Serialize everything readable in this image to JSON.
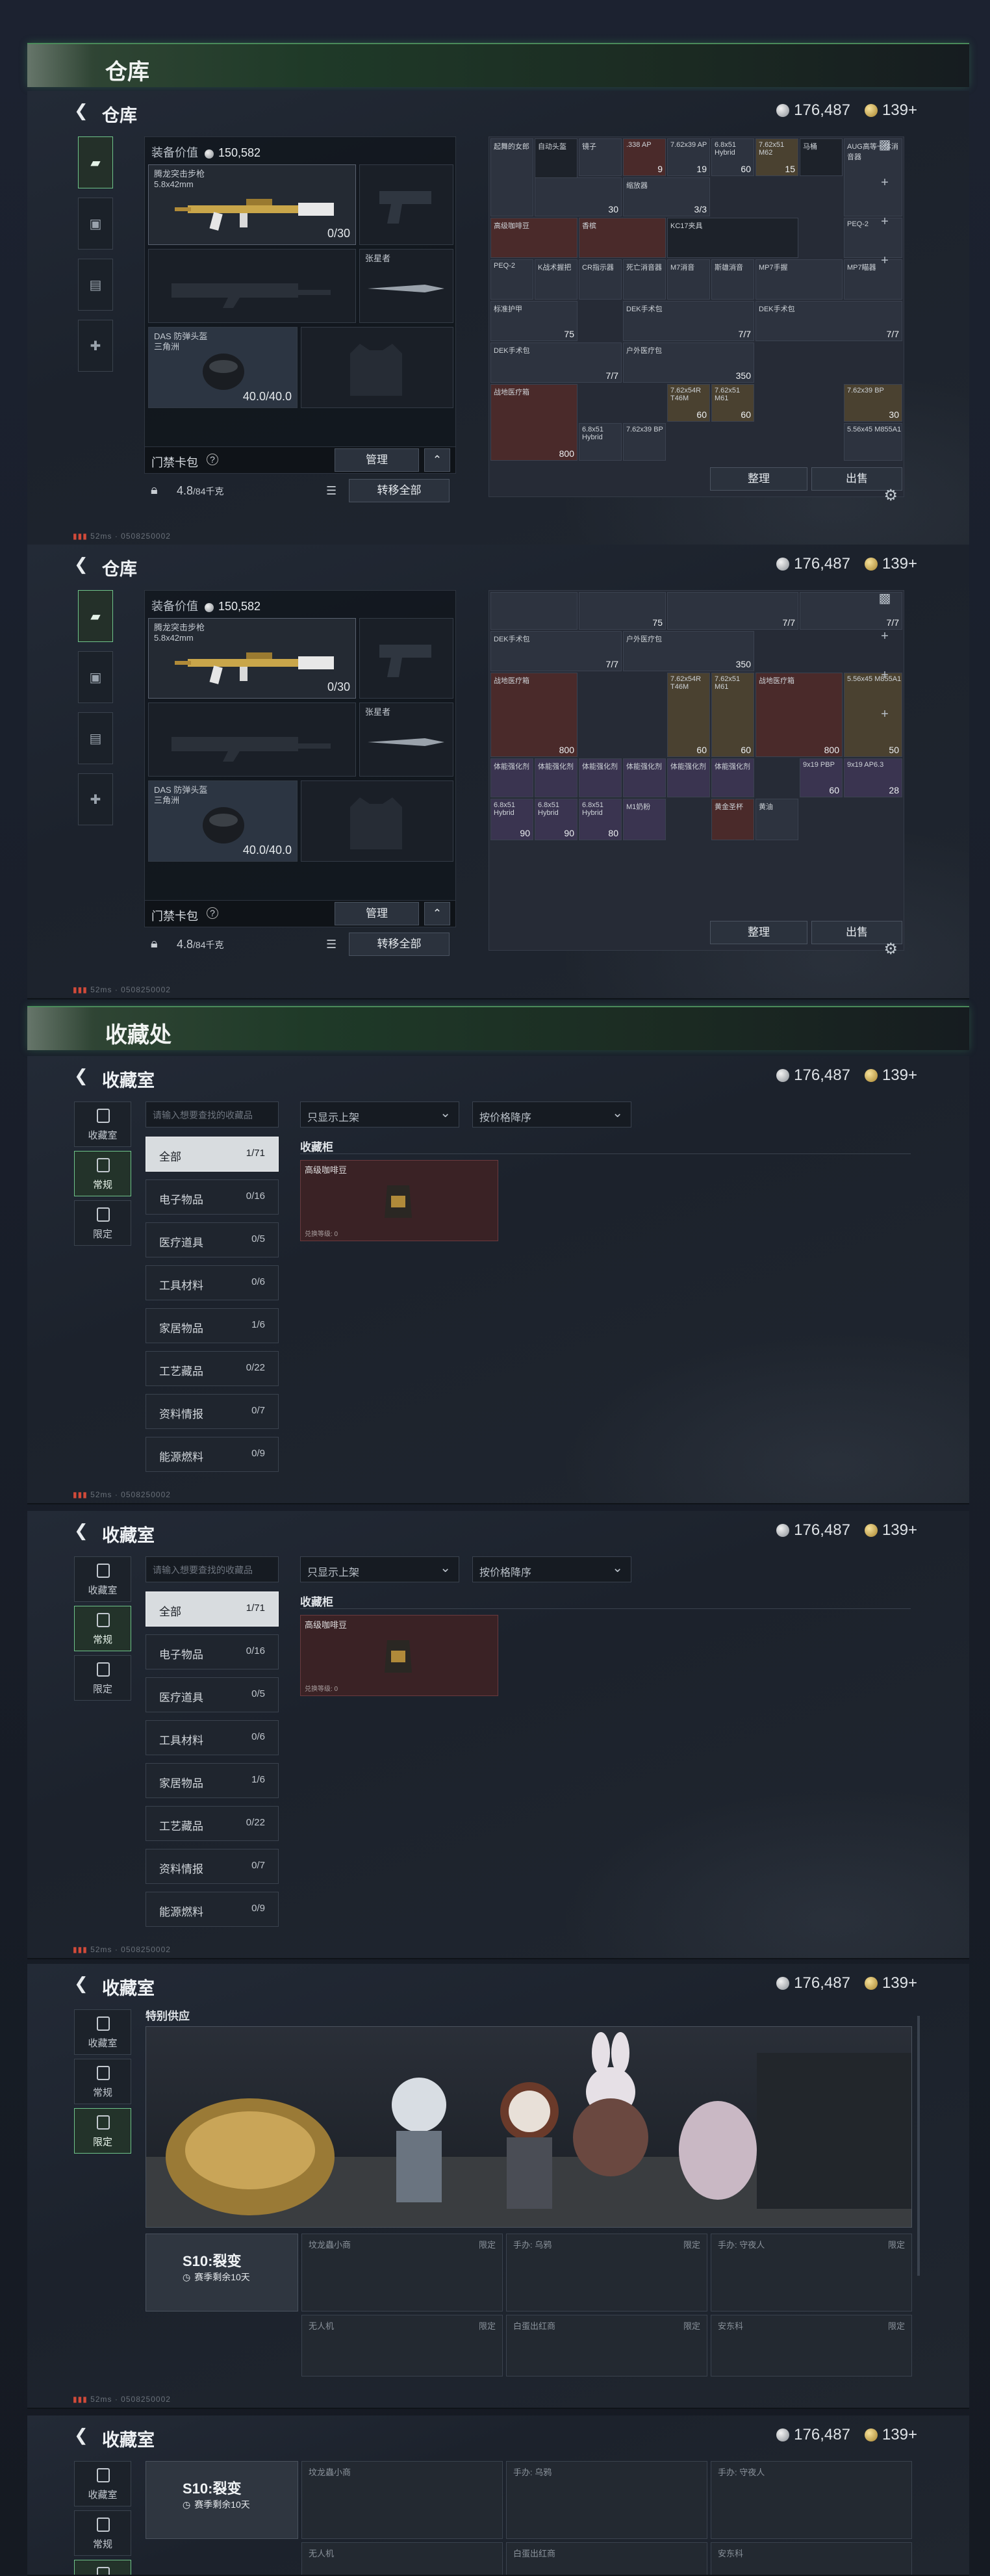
{
  "currency": {
    "silver": "176,487",
    "gold": "139+"
  },
  "warehouse_section": {
    "title": "仓库"
  },
  "warehouse": {
    "title": "仓库",
    "equip_value_label": "装备价值",
    "equip_value": "150,582",
    "primary_weapon_name": "腾龙突击步枪",
    "primary_weapon_caliber": "5.8x42mm",
    "primary_ammo": "0/30",
    "secondary_label": "张星者",
    "helmet_name": "DAS 防弹头盔",
    "helmet_sub": "三角洲",
    "helmet_durability": "40.0/40.0",
    "keycard_label": "门禁卡包",
    "manage_btn": "管理",
    "weight": "4.8",
    "weight_unit": "/84千克",
    "transfer_all_btn": "转移全部",
    "sort_btn": "整理",
    "sell_btn": "出售",
    "status_ping": "52ms",
    "status_id": "0508250002",
    "grid_items_top": [
      {
        "label": "起舞的女郎",
        "num": ""
      },
      {
        "label": "自动头盔",
        "num": ""
      },
      {
        "label": "镜子",
        "num": ""
      },
      {
        "label": ".338 AP",
        "num": "9"
      },
      {
        "label": "7.62x39 AP",
        "num": "19"
      },
      {
        "label": "6.8x51 Hybrid",
        "num": "60"
      },
      {
        "label": "7.62x51 M62",
        "num": "15"
      },
      {
        "label": "马桶",
        "num": ""
      },
      {
        "label": "AUG高等一体消音器",
        "num": ""
      },
      {
        "label": "",
        "num": "30"
      },
      {
        "label": "缩放器",
        "num": "3/3"
      },
      {
        "label": "高级咖啡豆",
        "num": ""
      },
      {
        "label": "香槟",
        "num": ""
      },
      {
        "label": "KC17夹具",
        "num": ""
      },
      {
        "label": "PEQ-2",
        "num": ""
      },
      {
        "label": "PEQ-2",
        "num": ""
      },
      {
        "label": "K战术握把",
        "num": ""
      },
      {
        "label": "CR指示器",
        "num": ""
      },
      {
        "label": "死亡消音器",
        "num": ""
      },
      {
        "label": "M7消音",
        "num": ""
      },
      {
        "label": "斯雄消音",
        "num": ""
      },
      {
        "label": "MP7手握",
        "num": ""
      },
      {
        "label": "MP7瞄器",
        "num": ""
      },
      {
        "label": "标准护甲",
        "num": "75"
      },
      {
        "label": "DEK手术包",
        "num": "7/7"
      },
      {
        "label": "DEK手术包",
        "num": "7/7"
      },
      {
        "label": "DEK手术包",
        "num": "7/7"
      },
      {
        "label": "户外医疗包",
        "num": "350"
      },
      {
        "label": "战地医疗箱",
        "num": "800"
      },
      {
        "label": "7.62x54R T46M",
        "num": "60"
      },
      {
        "label": "7.62x51 M61",
        "num": "60"
      },
      {
        "label": "7.62x39 BP",
        "num": "30"
      },
      {
        "label": "6.8x51 Hybrid",
        "num": ""
      },
      {
        "label": "7.62x39 BP",
        "num": ""
      },
      {
        "label": "5.56x45 M855A1",
        "num": ""
      }
    ],
    "grid_items_bottom": [
      {
        "label": "DEK手术包",
        "num": "7/7"
      },
      {
        "label": "户外医疗包",
        "num": "350"
      },
      {
        "label": "战地医疗箱",
        "num": "800"
      },
      {
        "label": "7.62x54R T46M",
        "num": "60"
      },
      {
        "label": "7.62x51 M61",
        "num": "60"
      },
      {
        "label": "战地医疗箱",
        "num": "800"
      },
      {
        "label": "5.56x45 M855A1",
        "num": "50"
      },
      {
        "label": "体能强化剂",
        "num": ""
      },
      {
        "label": "体能强化剂",
        "num": ""
      },
      {
        "label": "体能强化剂",
        "num": ""
      },
      {
        "label": "体能强化剂",
        "num": ""
      },
      {
        "label": "体能强化剂",
        "num": ""
      },
      {
        "label": "体能强化剂",
        "num": ""
      },
      {
        "label": "9x19 PBP",
        "num": "60"
      },
      {
        "label": "9x19 AP6.3",
        "num": "28"
      },
      {
        "label": "6.8x51 Hybrid",
        "num": "90"
      },
      {
        "label": "6.8x51 Hybrid",
        "num": "90"
      },
      {
        "label": "6.8x51 Hybrid",
        "num": "80"
      },
      {
        "label": "M1奶粉",
        "num": ""
      },
      {
        "label": "黄金圣杯",
        "num": ""
      },
      {
        "label": "黄油",
        "num": ""
      }
    ]
  },
  "collection_section": {
    "title": "收藏处"
  },
  "collection": {
    "title": "收藏室",
    "tabs": [
      "收藏室",
      "常规",
      "限定"
    ],
    "search_placeholder": "请输入想要查找的收藏品",
    "filter": "只显示上架",
    "sort": "按价格降序",
    "shelf_label": "收藏柜",
    "item_name": "高级咖啡豆",
    "item_foot": "兑换等级: 0",
    "categories": [
      {
        "name": "全部",
        "count": "1/71"
      },
      {
        "name": "电子物品",
        "count": "0/16"
      },
      {
        "name": "医疗道具",
        "count": "0/5"
      },
      {
        "name": "工具材料",
        "count": "0/6"
      },
      {
        "name": "家居物品",
        "count": "1/6"
      },
      {
        "name": "工艺藏品",
        "count": "0/22"
      },
      {
        "name": "资料情报",
        "count": "0/7"
      },
      {
        "name": "能源燃料",
        "count": "0/9"
      }
    ],
    "special_label": "特别供应",
    "season_title": "S10:裂变",
    "season_sub": "赛季剩余10天",
    "locked_items": [
      {
        "name": "坟龙蟲小商",
        "tag": "限定"
      },
      {
        "name": "手办: 乌鸦",
        "tag": "限定"
      },
      {
        "name": "手办: 守夜人",
        "tag": "限定"
      },
      {
        "name": "无人机",
        "tag": "限定"
      },
      {
        "name": "白蛋出红商",
        "tag": "限定"
      },
      {
        "name": "安东科",
        "tag": "限定"
      }
    ]
  },
  "status_ping": "52ms",
  "status_id": "0508250002"
}
